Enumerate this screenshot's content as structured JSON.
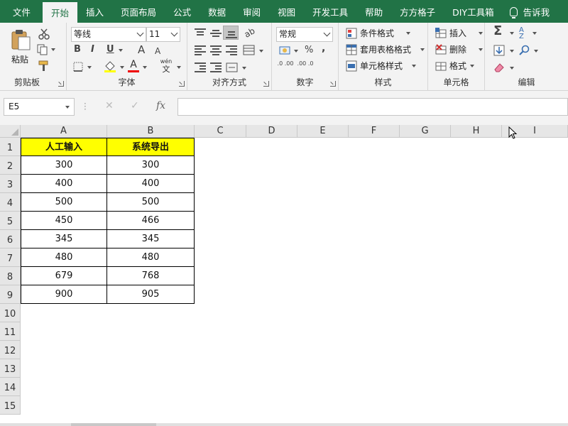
{
  "tabs": [
    "文件",
    "开始",
    "插入",
    "页面布局",
    "公式",
    "数据",
    "审阅",
    "视图",
    "开发工具",
    "帮助",
    "方方格子",
    "DIY工具箱",
    "告诉我"
  ],
  "active_tab": "开始",
  "ribbon": {
    "clipboard": {
      "label": "剪贴板",
      "paste": "粘贴"
    },
    "font": {
      "label": "字体",
      "font_name": "等线",
      "font_size": "11",
      "bold": "B",
      "italic": "I",
      "underline": "U",
      "grow": "A",
      "shrink": "A",
      "phonetic_top": "wén",
      "phonetic_bottom": "文"
    },
    "alignment": {
      "label": "对齐方式"
    },
    "number": {
      "label": "数字",
      "format": "常规",
      "percent": "%",
      "comma": ",",
      "inc_decimal": ".0 .00",
      "dec_decimal": ".00 .0"
    },
    "styles": {
      "label": "样式",
      "conditional": "条件格式",
      "table": "套用表格格式",
      "cell": "单元格样式"
    },
    "cells": {
      "label": "单元格",
      "insert": "插入",
      "delete": "删除",
      "format": "格式"
    },
    "editing": {
      "label": "编辑"
    }
  },
  "formula_bar": {
    "name_box": "E5",
    "formula": ""
  },
  "columns": [
    "A",
    "B",
    "C",
    "D",
    "E",
    "F",
    "G",
    "H",
    "I"
  ],
  "rows": [
    "1",
    "2",
    "3",
    "4",
    "5",
    "6",
    "7",
    "8",
    "9",
    "10",
    "11",
    "12",
    "13",
    "14",
    "15"
  ],
  "table": {
    "headers": [
      "人工输入",
      "系统导出"
    ],
    "data": [
      [
        "300",
        "300"
      ],
      [
        "400",
        "400"
      ],
      [
        "500",
        "500"
      ],
      [
        "450",
        "466"
      ],
      [
        "345",
        "345"
      ],
      [
        "480",
        "480"
      ],
      [
        "679",
        "768"
      ],
      [
        "900",
        "905"
      ]
    ]
  },
  "colors": {
    "accent": "#217346",
    "header_fill": "#ffff00"
  }
}
